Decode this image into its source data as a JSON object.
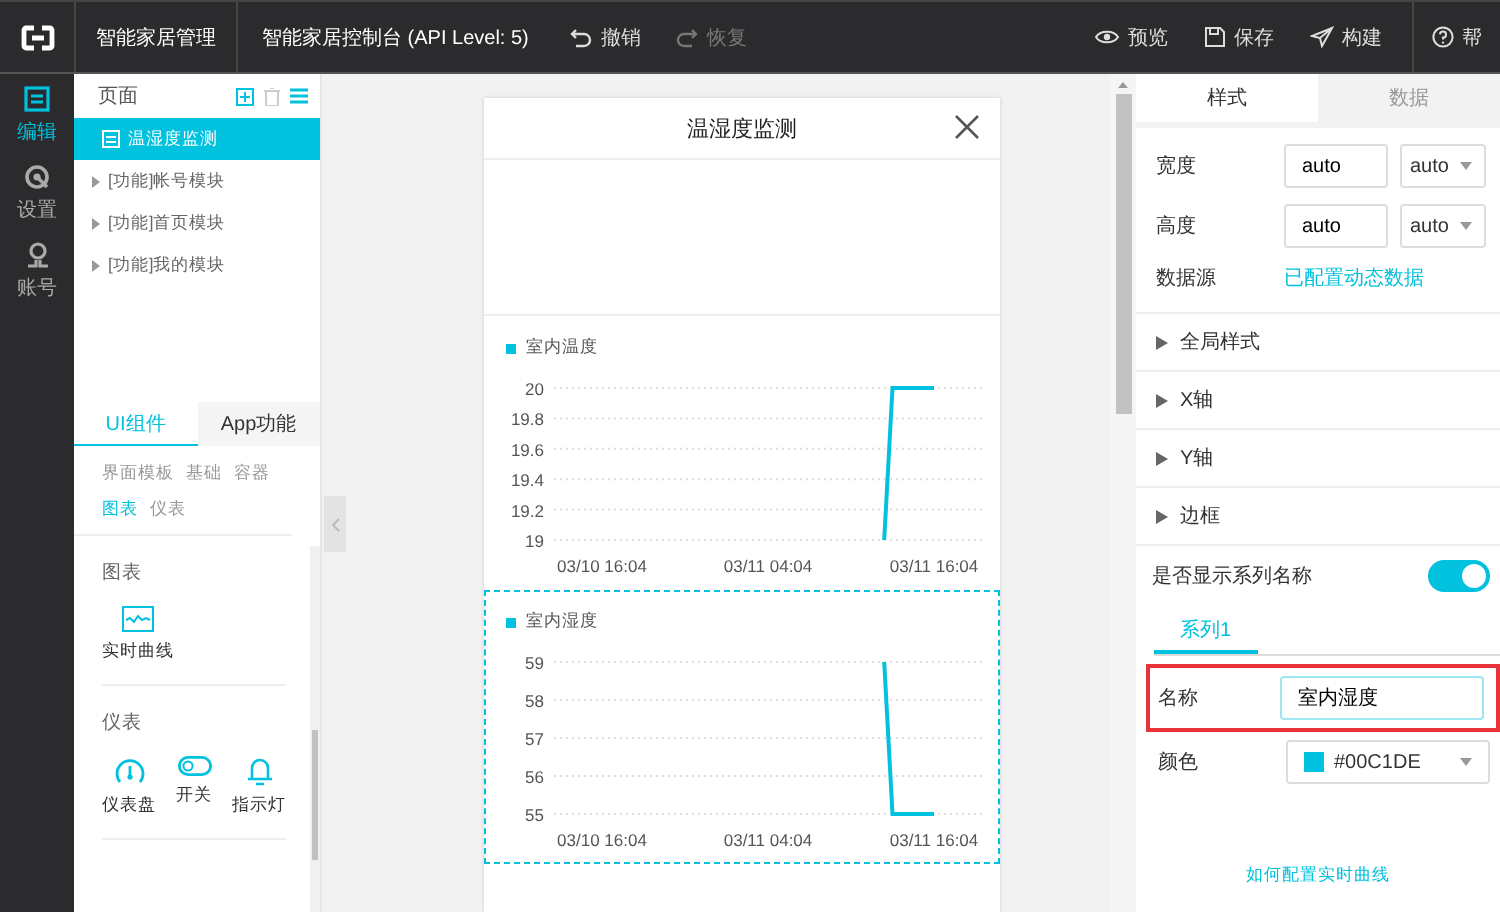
{
  "topbar": {
    "app_title": "智能家居管理",
    "project_title": "智能家居控制台 (API Level: 5)",
    "actions_left": [
      {
        "label": "撤销",
        "kind": "undo",
        "disabled": false
      },
      {
        "label": "恢复",
        "kind": "redo",
        "disabled": true
      }
    ],
    "actions_right": [
      {
        "label": "预览",
        "kind": "preview"
      },
      {
        "label": "保存",
        "kind": "save"
      },
      {
        "label": "构建",
        "kind": "build"
      },
      {
        "label": "帮",
        "kind": "help"
      }
    ]
  },
  "nav": [
    {
      "label": "编辑",
      "kind": "edit",
      "selected": true
    },
    {
      "label": "设置",
      "kind": "settings",
      "selected": false
    },
    {
      "label": "账号",
      "kind": "account",
      "selected": false
    }
  ],
  "pages": {
    "title": "页面",
    "items": [
      {
        "label": "温湿度监测",
        "kind": "page",
        "selected": true
      },
      {
        "label": "[功能]帐号模块",
        "kind": "module",
        "selected": false
      },
      {
        "label": "[功能]首页模块",
        "kind": "module",
        "selected": false
      },
      {
        "label": "[功能]我的模块",
        "kind": "module",
        "selected": false
      }
    ]
  },
  "component_tabs": [
    {
      "label": "UI组件",
      "selected": true
    },
    {
      "label": "App功能",
      "selected": false
    }
  ],
  "categories": [
    {
      "label": "界面模板",
      "selected": false
    },
    {
      "label": "基础",
      "selected": false
    },
    {
      "label": "容器",
      "selected": false
    },
    {
      "label": "图表",
      "selected": true
    },
    {
      "label": "仪表",
      "selected": false
    }
  ],
  "groups": [
    {
      "title": "图表",
      "items": [
        {
          "label": "实时曲线",
          "kind": "curve"
        }
      ]
    },
    {
      "title": "仪表",
      "items": [
        {
          "label": "仪表盘",
          "kind": "gauge"
        },
        {
          "label": "开关",
          "kind": "switch"
        },
        {
          "label": "指示灯",
          "kind": "light"
        }
      ]
    }
  ],
  "preview": {
    "title": "温湿度监测",
    "charts": [
      {
        "selected": false,
        "chart_data": {
          "type": "line",
          "grid": true,
          "categories": [
            "03/10 16:04",
            null,
            null,
            null,
            null,
            null,
            null,
            null,
            null,
            null,
            null,
            null,
            null,
            null,
            null,
            null,
            null,
            null,
            null,
            null,
            "03/11 04:04",
            null,
            null,
            null,
            null,
            null,
            null,
            null,
            null,
            null,
            null,
            null,
            null,
            null,
            null,
            null,
            null,
            null,
            null,
            null,
            "03/11 16:04"
          ],
          "series": [
            {
              "name": "室内温度",
              "color": "#00c1de",
              "values": [
                null,
                null,
                null,
                null,
                null,
                null,
                null,
                null,
                null,
                null,
                null,
                null,
                null,
                null,
                null,
                null,
                null,
                null,
                null,
                null,
                null,
                null,
                null,
                null,
                null,
                null,
                null,
                null,
                null,
                null,
                null,
                null,
                null,
                null,
                19,
                20,
                20,
                20,
                20,
                20,
                20
              ]
            }
          ],
          "ylim": [
            19,
            20
          ],
          "yticks": [
            {
              "value": 19,
              "label": "19"
            },
            {
              "value": 19.2,
              "label": "19.2"
            },
            {
              "value": 19.4,
              "label": "19.4"
            },
            {
              "value": 19.6,
              "label": "19.6"
            },
            {
              "value": 19.8,
              "label": "19.8"
            },
            {
              "value": 20,
              "label": "20"
            }
          ]
        }
      },
      {
        "selected": true,
        "chart_data": {
          "type": "line",
          "grid": true,
          "categories": [
            "03/10 16:04",
            null,
            null,
            null,
            null,
            null,
            null,
            null,
            null,
            null,
            null,
            null,
            null,
            null,
            null,
            null,
            null,
            null,
            null,
            null,
            "03/11 04:04",
            null,
            null,
            null,
            null,
            null,
            null,
            null,
            null,
            null,
            null,
            null,
            null,
            null,
            null,
            null,
            null,
            null,
            null,
            null,
            "03/11 16:04"
          ],
          "series": [
            {
              "name": "室内湿度",
              "color": "#00c1de",
              "values": [
                null,
                null,
                null,
                null,
                null,
                null,
                null,
                null,
                null,
                null,
                null,
                null,
                null,
                null,
                null,
                null,
                null,
                null,
                null,
                null,
                null,
                null,
                null,
                null,
                null,
                null,
                null,
                null,
                null,
                null,
                null,
                null,
                null,
                null,
                59,
                55,
                55,
                55,
                55,
                55,
                55
              ]
            }
          ],
          "ylim": [
            55,
            59
          ],
          "yticks": [
            55,
            56,
            57,
            58,
            59
          ]
        }
      }
    ]
  },
  "properties": {
    "tabs": [
      {
        "label": "样式",
        "selected": true
      },
      {
        "label": "数据",
        "selected": false
      }
    ],
    "fields": [
      {
        "label": "宽度",
        "value": "auto",
        "unit": "auto"
      },
      {
        "label": "高度",
        "value": "auto",
        "unit": "auto"
      }
    ],
    "data_source": {
      "label": "数据源",
      "link": "已配置动态数据"
    },
    "sections": [
      {
        "label": "全局样式",
        "expanded": false
      },
      {
        "label": "X轴",
        "expanded": false
      },
      {
        "label": "Y轴",
        "expanded": false
      },
      {
        "label": "边框",
        "expanded": false
      }
    ],
    "show_series_name": {
      "label": "是否显示系列名称",
      "on": true
    },
    "series_tabs": [
      {
        "label": "系列1",
        "selected": true
      }
    ],
    "name": {
      "label": "名称",
      "value": "室内湿度",
      "highlighted": true
    },
    "color": {
      "label": "颜色",
      "value": "#00C1DE"
    },
    "help_link": "如何配置实时曲线"
  }
}
